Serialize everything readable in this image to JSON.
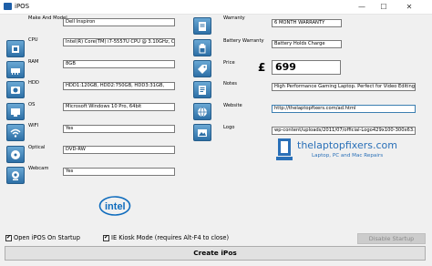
{
  "window": {
    "title": "iPOS",
    "minimize": "—",
    "maximize": "☐",
    "close": "✕"
  },
  "left": {
    "labels": [
      "Make And Model",
      "CPU",
      "RAM",
      "HDD",
      "OS",
      "WIFI",
      "Optical",
      "Webcam"
    ],
    "values": [
      "Dell Inspiron",
      "Intel(R) Core(TM) i7-5557U CPU @ 3.10GHz, Cores 2",
      "8GB",
      "HDD1:120GB,  HDD2:750GB,  HDD3:31GB,",
      "Microsoft Windows 10 Pro, 64bit",
      "Yes",
      "DVD-RW",
      "Yes"
    ]
  },
  "right": {
    "labels": [
      "Warranty",
      "Battery Warranty",
      "Price",
      "Notes",
      "Website",
      "Logo"
    ],
    "warranty": "6 MONTH WARRANTY",
    "battery": "Battery Holds Charge",
    "currency": "£",
    "price": "699",
    "notes": "High Performance Gaming Laptop. Perfect for Video Editing",
    "website": "http://thelaptopfixers.com/ad.html",
    "logo": "wp-content/uploads/2011/07/official-Logo429x100-300x63.png"
  },
  "logo": {
    "name": "thelaptopfixers.com",
    "tagline": "Laptop, PC and Mac Repairs"
  },
  "brand": "intel",
  "options": {
    "open_on_startup": "Open iPOS On Startup",
    "kiosk_mode": "IE Kiosk Mode (requires Alt-F4 to close)",
    "check_mark": "✔"
  },
  "buttons": {
    "disable_startup": "Disable Startup",
    "create": "Create iPos"
  },
  "colors": {
    "tile": "#3a7db5",
    "logo_text": "#2a70b8",
    "intel": "#0f6cbd"
  }
}
